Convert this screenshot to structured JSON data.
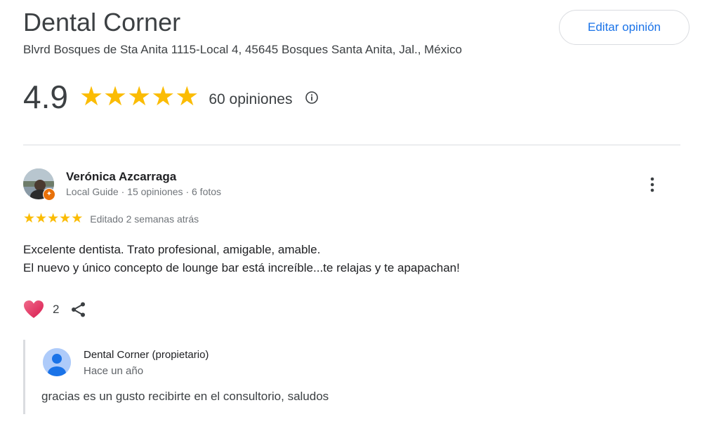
{
  "business": {
    "name": "Dental Corner",
    "address": "Blvrd Bosques de Sta Anita 1115-Local 4, 45645 Bosques Santa Anita, Jal., México",
    "edit_button_label": "Editar opinión"
  },
  "rating": {
    "value": "4.9",
    "stars": 5,
    "review_count_label": "60 opiniones",
    "info_icon": "info-icon"
  },
  "review": {
    "reviewer_name": "Verónica Azcarraga",
    "reviewer_meta": "Local Guide · 15 opiniones · 6 fotos",
    "stars": 5,
    "edited_label": "Editado 2 semanas atrás",
    "text_lines": [
      "Excelente dentista. Trato profesional, amigable, amable.",
      "El nuevo y único concepto de lounge bar está increíble...te relajas y te apapachan!"
    ],
    "like_count": "2",
    "icons": [
      "heart-icon",
      "share-icon",
      "more-vert-icon"
    ]
  },
  "owner_response": {
    "name": "Dental Corner (propietario)",
    "date": "Hace un año",
    "text": "gracias es un gusto recibirte en el consultorio, saludos"
  },
  "colors": {
    "star": "#fbbc04",
    "accent_blue": "#1a73e8",
    "heart": "#e8336d",
    "guide_badge": "#e8710a"
  }
}
